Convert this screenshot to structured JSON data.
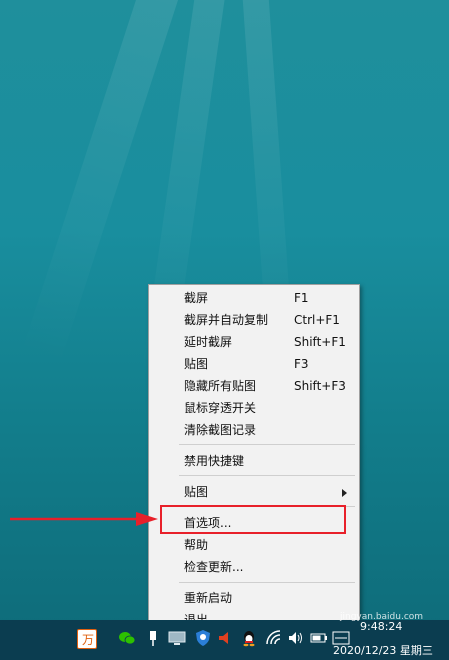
{
  "menu": {
    "items": [
      {
        "label": "截屏",
        "shortcut": "F1"
      },
      {
        "label": "截屏并自动复制",
        "shortcut": "Ctrl+F1"
      },
      {
        "label": "延时截屏",
        "shortcut": "Shift+F1"
      },
      {
        "label": "贴图",
        "shortcut": "F3"
      },
      {
        "label": "隐藏所有贴图",
        "shortcut": "Shift+F3"
      },
      {
        "label": "鼠标穿透开关",
        "shortcut": ""
      },
      {
        "label": "清除截图记录",
        "shortcut": ""
      },
      {
        "label": "禁用快捷键",
        "shortcut": ""
      },
      {
        "label": "贴图",
        "shortcut": ""
      },
      {
        "label": "首选项...",
        "shortcut": ""
      },
      {
        "label": "帮助",
        "shortcut": ""
      },
      {
        "label": "检查更新...",
        "shortcut": ""
      },
      {
        "label": "重新启动",
        "shortcut": ""
      },
      {
        "label": "退出",
        "shortcut": ""
      }
    ]
  },
  "taskbar": {
    "time": "9:48:24",
    "date": "2020/12/23 星期三",
    "icons": [
      "app-orange-icon",
      "wechat-icon",
      "pin-icon",
      "monitor-icon",
      "shield-icon",
      "volume-warning-icon",
      "qq-icon",
      "wifi-icon",
      "speaker-icon",
      "battery-icon",
      "input-method-icon"
    ]
  },
  "watermark": "jingyan.baidu.com",
  "colors": {
    "highlight": "#e8202a",
    "taskbar": "#0b3d50"
  }
}
